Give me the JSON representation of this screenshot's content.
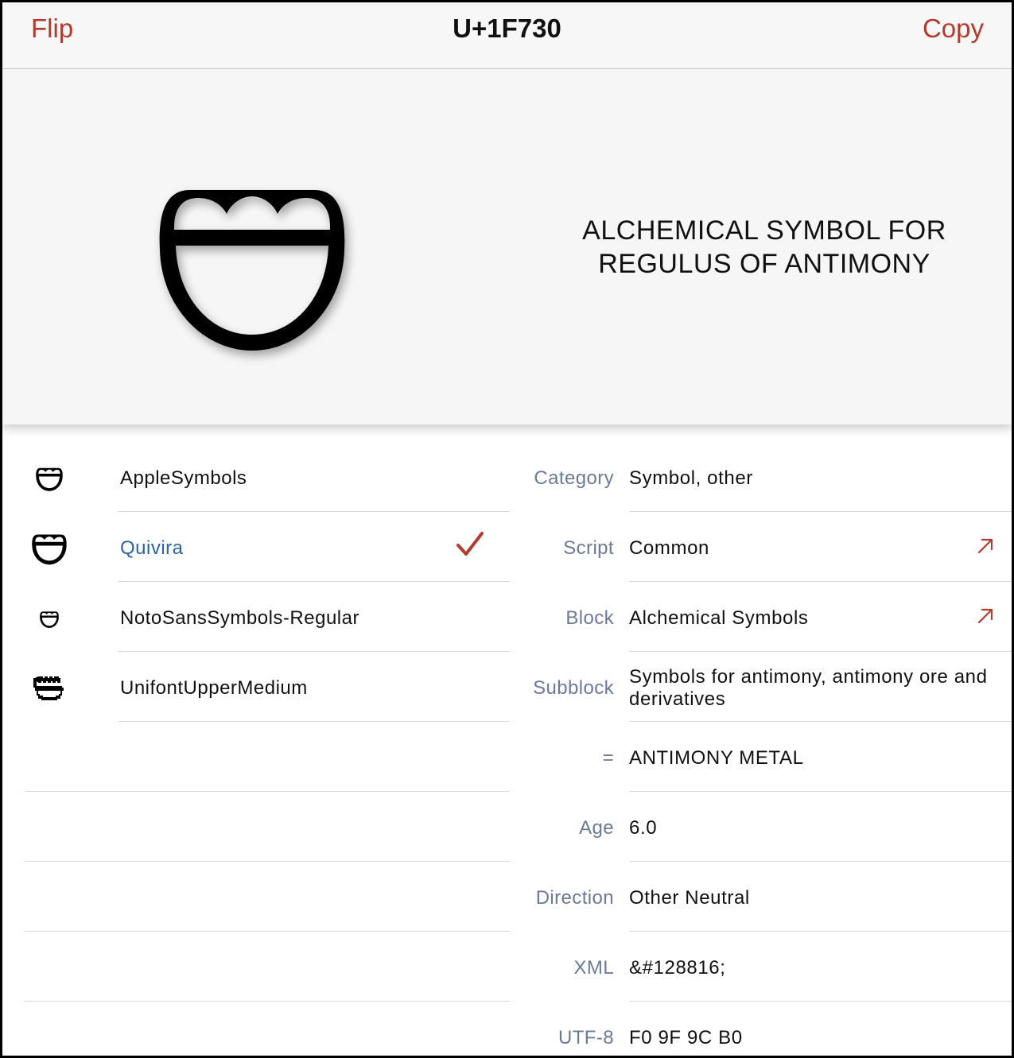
{
  "nav": {
    "flip_label": "Flip",
    "title": "U+1F730",
    "copy_label": "Copy",
    "accent_color": "#b43a2e"
  },
  "hero": {
    "glyph_icon": "regulus-of-antimony-glyph",
    "name_line1": "ALCHEMICAL SYMBOL FOR",
    "name_line2": "REGULUS OF ANTIMONY"
  },
  "fonts": [
    {
      "name": "AppleSymbols",
      "icon": "regulus-glyph-icon",
      "selected": false
    },
    {
      "name": "Quivira",
      "icon": "regulus-glyph-icon",
      "selected": true
    },
    {
      "name": "NotoSansSymbols-Regular",
      "icon": "regulus-glyph-icon",
      "selected": false
    },
    {
      "name": "UnifontUpperMedium",
      "icon": "regulus-pixel-glyph-icon",
      "selected": false
    }
  ],
  "properties": [
    {
      "key": "Category",
      "value": "Symbol, other"
    },
    {
      "key": "Script",
      "value": "Common",
      "link_icon": "arrow-up-right-icon"
    },
    {
      "key": "Block",
      "value": "Alchemical Symbols",
      "link_icon": "arrow-up-right-icon"
    },
    {
      "key": "Subblock",
      "value": "Symbols for antimony, antimony ore and derivatives"
    },
    {
      "key": "=",
      "value": "ANTIMONY METAL"
    },
    {
      "key": "Age",
      "value": "6.0"
    },
    {
      "key": "Direction",
      "value": "Other Neutral"
    },
    {
      "key": "XML",
      "value": "&#128816;"
    },
    {
      "key": "UTF-8",
      "value": "F0 9F 9C B0"
    }
  ],
  "colors": {
    "selected_text": "#2b63a8",
    "key_text": "#6b7a99",
    "check_mark": "#b43a2e"
  }
}
